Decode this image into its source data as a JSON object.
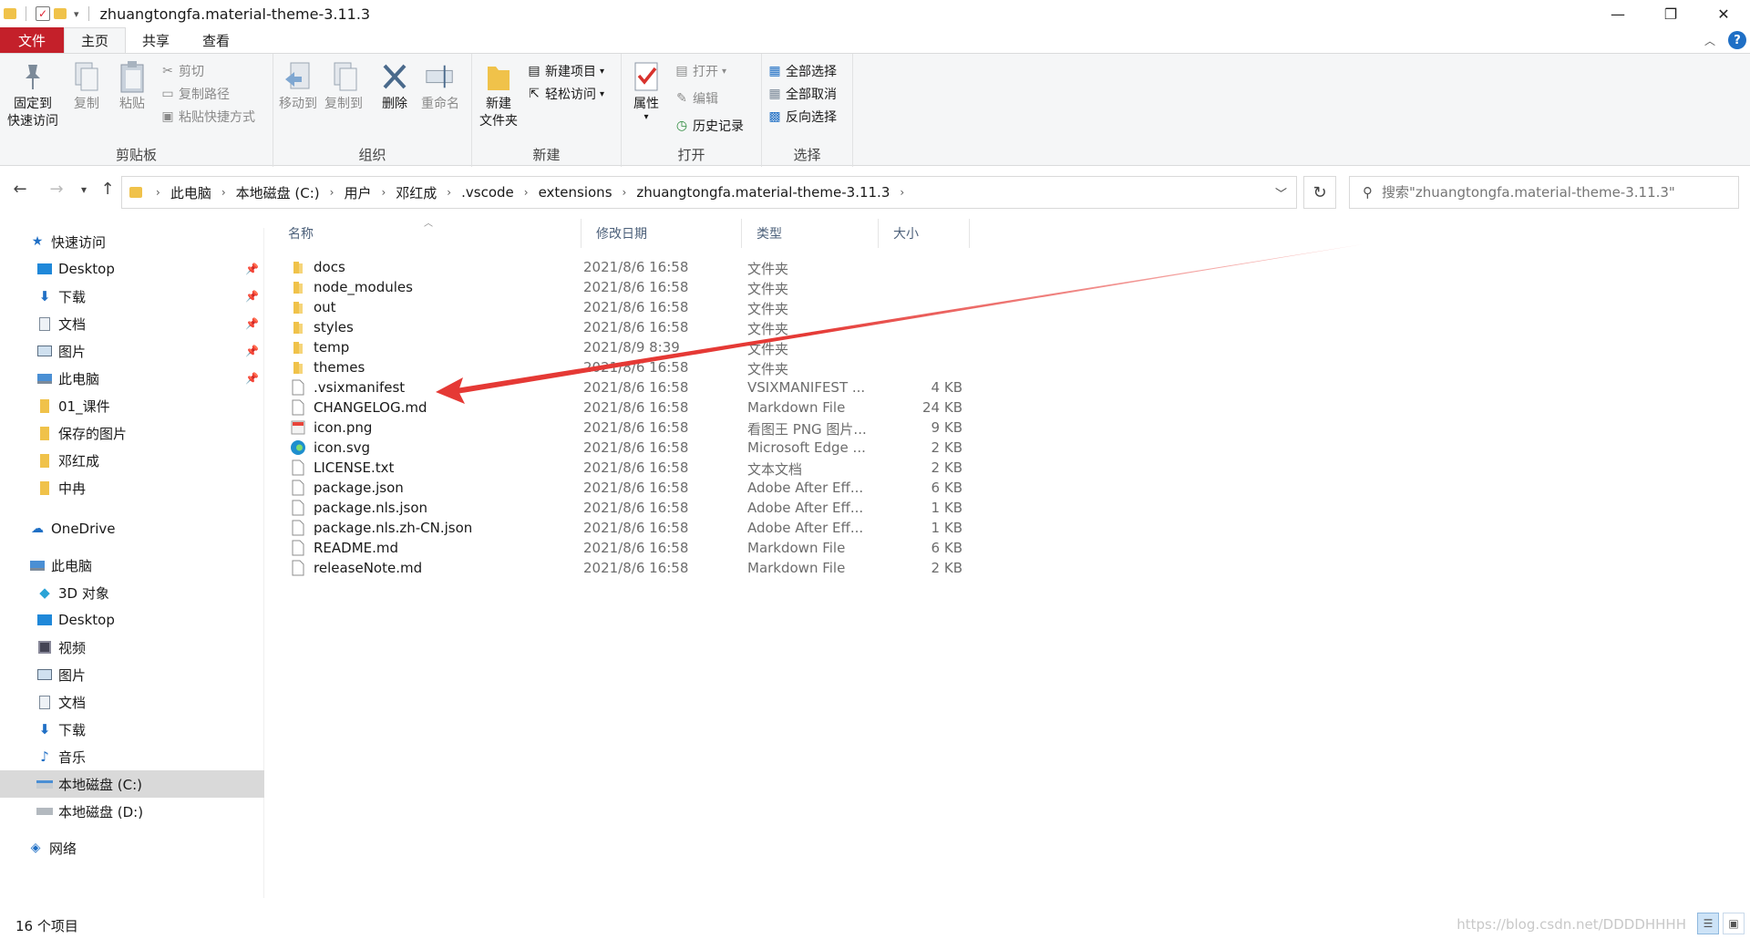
{
  "window": {
    "title": "zhuangtongfa.material-theme-3.11.3",
    "minimize": "—",
    "restore": "❐",
    "close": "✕"
  },
  "tabs": {
    "file": "文件",
    "home": "主页",
    "share": "共享",
    "view": "查看"
  },
  "ribbon": {
    "clipboard": {
      "label": "剪贴板",
      "pin_line1": "固定到",
      "pin_line2": "快速访问",
      "copy": "复制",
      "paste": "粘贴",
      "cut": "剪切",
      "copy_path": "复制路径",
      "paste_shortcut": "粘贴快捷方式"
    },
    "organize": {
      "label": "组织",
      "move_to": "移动到",
      "copy_to": "复制到",
      "delete": "删除",
      "rename": "重命名"
    },
    "new": {
      "label": "新建",
      "new_folder_line1": "新建",
      "new_folder_line2": "文件夹",
      "new_item": "新建项目",
      "easy_access": "轻松访问"
    },
    "open": {
      "label": "打开",
      "properties": "属性",
      "open": "打开",
      "edit": "编辑",
      "history": "历史记录"
    },
    "select": {
      "label": "选择",
      "select_all": "全部选择",
      "select_none": "全部取消",
      "invert": "反向选择"
    }
  },
  "address": {
    "crumbs": [
      "此电脑",
      "本地磁盘 (C:)",
      "用户",
      "邓红成",
      ".vscode",
      "extensions",
      "zhuangtongfa.material-theme-3.11.3"
    ],
    "search_placeholder": "搜索\"zhuangtongfa.material-theme-3.11.3\""
  },
  "sidebar": {
    "quick_access": "快速访问",
    "quick_items": [
      {
        "label": "Desktop",
        "pinned": true
      },
      {
        "label": "下载",
        "pinned": true
      },
      {
        "label": "文档",
        "pinned": true
      },
      {
        "label": "图片",
        "pinned": true
      },
      {
        "label": "此电脑",
        "pinned": true
      },
      {
        "label": "01_课件",
        "pinned": false
      },
      {
        "label": "保存的图片",
        "pinned": false
      },
      {
        "label": "邓红成",
        "pinned": false
      },
      {
        "label": "中冉",
        "pinned": false
      }
    ],
    "onedrive": "OneDrive",
    "this_pc": "此电脑",
    "pc_items": [
      "3D 对象",
      "Desktop",
      "视频",
      "图片",
      "文档",
      "下载",
      "音乐",
      "本地磁盘 (C:)",
      "本地磁盘 (D:)"
    ],
    "network": "网络"
  },
  "columns": {
    "name": "名称",
    "date": "修改日期",
    "type": "类型",
    "size": "大小"
  },
  "files": [
    {
      "name": "docs",
      "date": "2021/8/6 16:58",
      "type": "文件夹",
      "size": "",
      "icon": "folder-icon"
    },
    {
      "name": "node_modules",
      "date": "2021/8/6 16:58",
      "type": "文件夹",
      "size": "",
      "icon": "folder-icon"
    },
    {
      "name": "out",
      "date": "2021/8/6 16:58",
      "type": "文件夹",
      "size": "",
      "icon": "folder-icon"
    },
    {
      "name": "styles",
      "date": "2021/8/6 16:58",
      "type": "文件夹",
      "size": "",
      "icon": "folder-icon"
    },
    {
      "name": "temp",
      "date": "2021/8/9 8:39",
      "type": "文件夹",
      "size": "",
      "icon": "folder-icon"
    },
    {
      "name": "themes",
      "date": "2021/8/6 16:58",
      "type": "文件夹",
      "size": "",
      "icon": "folder-icon"
    },
    {
      "name": ".vsixmanifest",
      "date": "2021/8/6 16:58",
      "type": "VSIXMANIFEST ...",
      "size": "4 KB",
      "icon": "blank-file-icon"
    },
    {
      "name": "CHANGELOG.md",
      "date": "2021/8/6 16:58",
      "type": "Markdown File",
      "size": "24 KB",
      "icon": "markdown-file-icon"
    },
    {
      "name": "icon.png",
      "date": "2021/8/6 16:58",
      "type": "看图王 PNG 图片...",
      "size": "9 KB",
      "icon": "image-file-icon"
    },
    {
      "name": "icon.svg",
      "date": "2021/8/6 16:58",
      "type": "Microsoft Edge ...",
      "size": "2 KB",
      "icon": "edge-icon"
    },
    {
      "name": "LICENSE.txt",
      "date": "2021/8/6 16:58",
      "type": "文本文档",
      "size": "2 KB",
      "icon": "text-file-icon"
    },
    {
      "name": "package.json",
      "date": "2021/8/6 16:58",
      "type": "Adobe After Eff...",
      "size": "6 KB",
      "icon": "json-file-icon"
    },
    {
      "name": "package.nls.json",
      "date": "2021/8/6 16:58",
      "type": "Adobe After Eff...",
      "size": "1 KB",
      "icon": "json-file-icon"
    },
    {
      "name": "package.nls.zh-CN.json",
      "date": "2021/8/6 16:58",
      "type": "Adobe After Eff...",
      "size": "1 KB",
      "icon": "json-file-icon"
    },
    {
      "name": "README.md",
      "date": "2021/8/6 16:58",
      "type": "Markdown File",
      "size": "6 KB",
      "icon": "markdown-file-icon"
    },
    {
      "name": "releaseNote.md",
      "date": "2021/8/6 16:58",
      "type": "Markdown File",
      "size": "2 KB",
      "icon": "markdown-file-icon"
    }
  ],
  "status": {
    "count": "16 个项目",
    "watermark": "https://blog.csdn.net/DDDDHHHH"
  },
  "colors": {
    "file_tab": "#c4202a",
    "folder": "#f0c24a",
    "selection": "#d9d9d9",
    "annotation_arrow": "#e53935"
  }
}
